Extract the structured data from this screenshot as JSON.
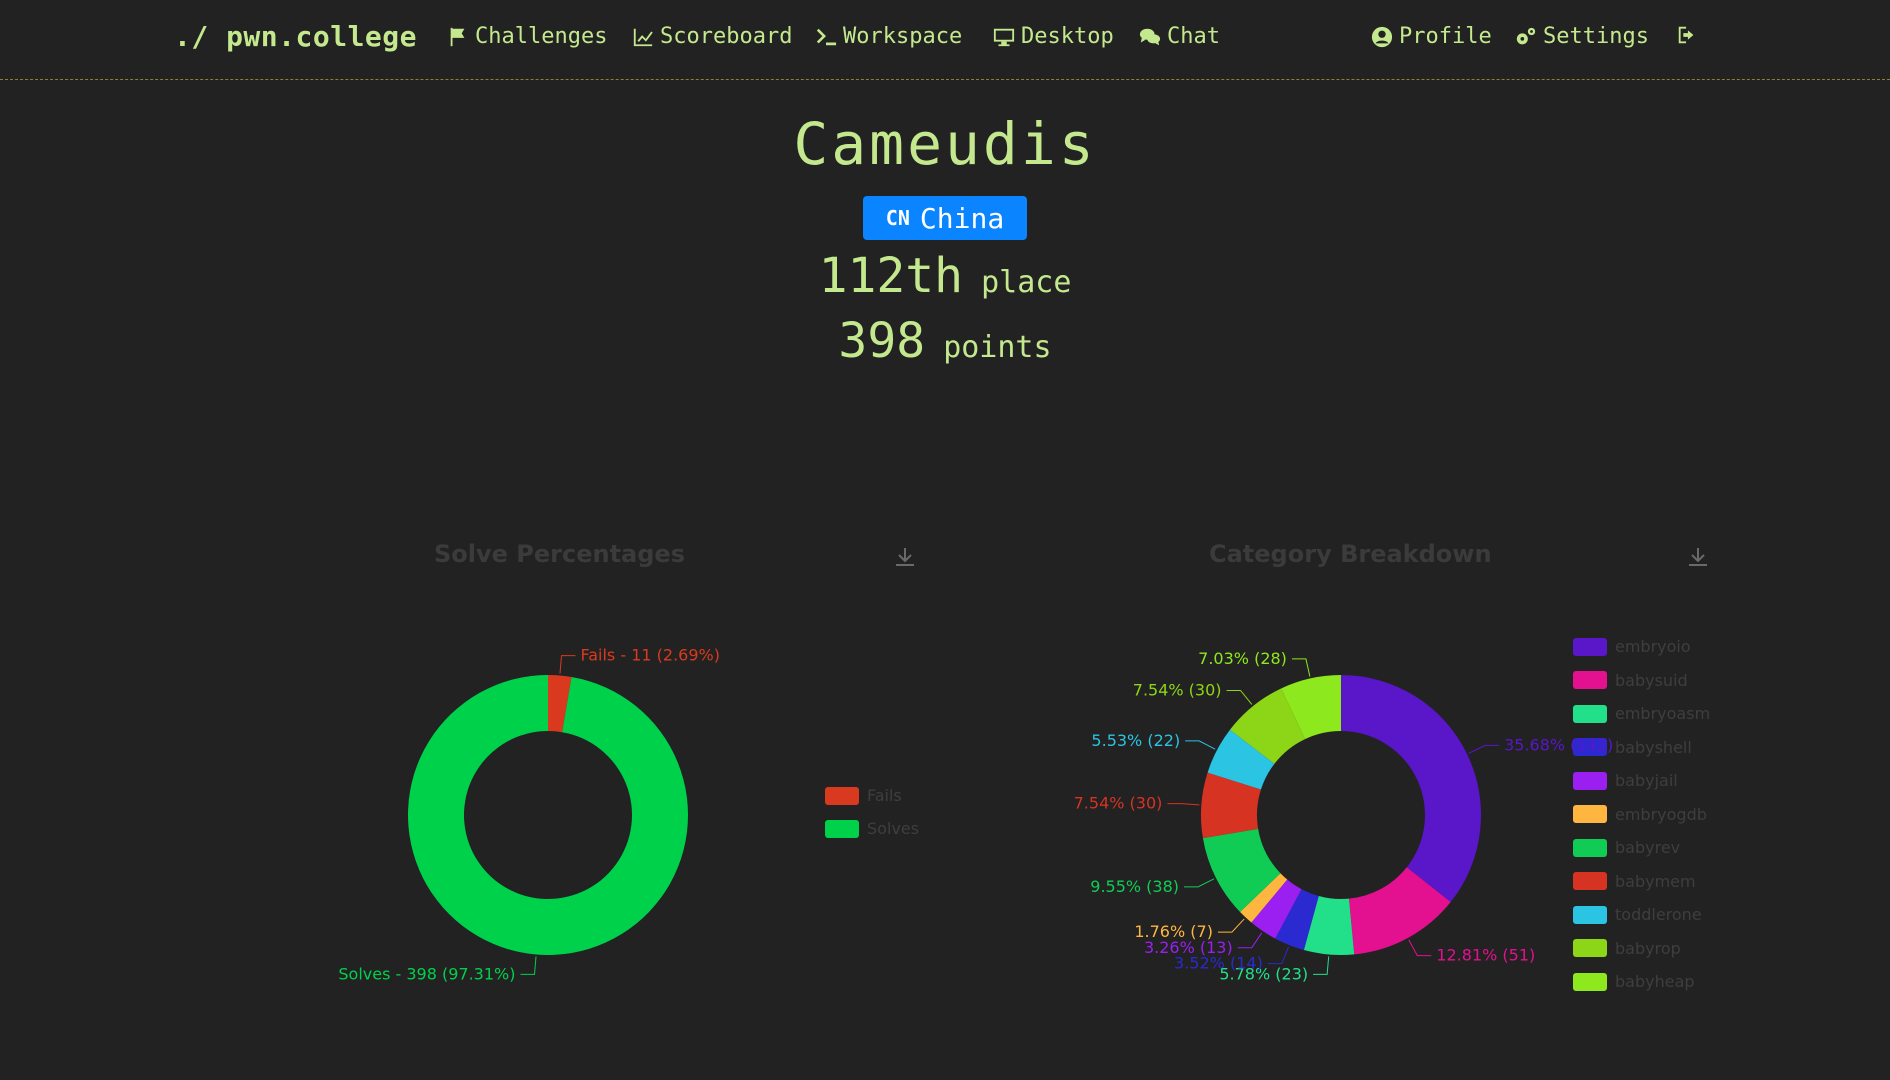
{
  "navbar": {
    "brand": "./ pwn.college",
    "items": [
      {
        "label": "Challenges",
        "icon": "flag-icon"
      },
      {
        "label": "Scoreboard",
        "icon": "chart-line-icon"
      },
      {
        "label": "Workspace",
        "icon": "terminal-icon"
      },
      {
        "label": "Desktop",
        "icon": "desktop-icon"
      },
      {
        "label": "Chat",
        "icon": "comments-icon"
      },
      {
        "label": "Profile",
        "icon": "user-circle-icon"
      },
      {
        "label": "Settings",
        "icon": "cogs-icon"
      },
      {
        "label": "",
        "icon": "sign-out-icon"
      }
    ]
  },
  "profile": {
    "name": "Cameudis",
    "country_code": "CN",
    "country": "China",
    "rank": "112th",
    "rank_suffix": "place",
    "points": "398",
    "points_suffix": "points"
  },
  "colors": {
    "accent": "#c3e88d",
    "badge": "#0a84ff"
  },
  "chart_data": [
    {
      "type": "pie",
      "title": "Solve Percentages",
      "series": [
        {
          "name": "Fails",
          "value": 11,
          "label": "Fails - 11 (2.69%)",
          "color": "#d93a1f"
        },
        {
          "name": "Solves",
          "value": 398,
          "label": "Solves - 398 (97.31%)",
          "color": "#00d14b"
        }
      ],
      "legend_position": "right"
    },
    {
      "type": "pie",
      "title": "Category Breakdown",
      "series": [
        {
          "name": "embryoio",
          "value": 142,
          "label": "35.68% (142)",
          "color": "#5a16c9"
        },
        {
          "name": "babysuid",
          "value": 51,
          "label": "12.81% (51)",
          "color": "#e3108f"
        },
        {
          "name": "embryoasm",
          "value": 23,
          "label": "5.78% (23)",
          "color": "#22e08a"
        },
        {
          "name": "babyshell",
          "value": 14,
          "label": "3.52% (14)",
          "color": "#2a2ad0"
        },
        {
          "name": "babyjail",
          "value": 13,
          "label": "3.26% (13)",
          "color": "#9a1ff0"
        },
        {
          "name": "embryogdb",
          "value": 7,
          "label": "1.76% (7)",
          "color": "#ffb640"
        },
        {
          "name": "babyrev",
          "value": 38,
          "label": "9.55% (38)",
          "color": "#10cc55"
        },
        {
          "name": "babymem",
          "value": 30,
          "label": "7.54% (30)",
          "color": "#d63322"
        },
        {
          "name": "toddlerone",
          "value": 22,
          "label": "5.53% (22)",
          "color": "#2bc4e2"
        },
        {
          "name": "babyrop",
          "value": 30,
          "label": "7.54% (30)",
          "color": "#8cd617"
        },
        {
          "name": "babyheap",
          "value": 28,
          "label": "7.03% (28)",
          "color": "#8de81d"
        }
      ],
      "legend_position": "right"
    }
  ]
}
